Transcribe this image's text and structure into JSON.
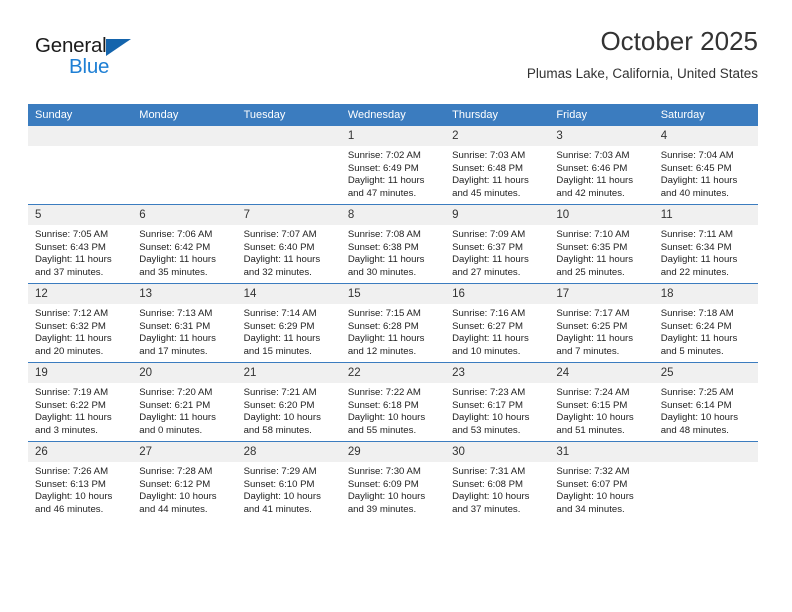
{
  "brand": {
    "name_top": "General",
    "name_bottom": "Blue",
    "triangle_color": "#1464ac",
    "blue_color": "#1e7fd4"
  },
  "header": {
    "title": "October 2025",
    "subtitle": "Plumas Lake, California, United States"
  },
  "theme": {
    "header_blue": "#3b7cbf",
    "daynum_gray": "#f0f0f0",
    "text": "#222222"
  },
  "weekdays": [
    "Sunday",
    "Monday",
    "Tuesday",
    "Wednesday",
    "Thursday",
    "Friday",
    "Saturday"
  ],
  "weeks": [
    [
      {
        "day": "",
        "empty": true
      },
      {
        "day": "",
        "empty": true
      },
      {
        "day": "",
        "empty": true
      },
      {
        "day": "1",
        "sunrise": "Sunrise: 7:02 AM",
        "sunset": "Sunset: 6:49 PM",
        "daylight_1": "Daylight: 11 hours",
        "daylight_2": "and 47 minutes."
      },
      {
        "day": "2",
        "sunrise": "Sunrise: 7:03 AM",
        "sunset": "Sunset: 6:48 PM",
        "daylight_1": "Daylight: 11 hours",
        "daylight_2": "and 45 minutes."
      },
      {
        "day": "3",
        "sunrise": "Sunrise: 7:03 AM",
        "sunset": "Sunset: 6:46 PM",
        "daylight_1": "Daylight: 11 hours",
        "daylight_2": "and 42 minutes."
      },
      {
        "day": "4",
        "sunrise": "Sunrise: 7:04 AM",
        "sunset": "Sunset: 6:45 PM",
        "daylight_1": "Daylight: 11 hours",
        "daylight_2": "and 40 minutes."
      }
    ],
    [
      {
        "day": "5",
        "sunrise": "Sunrise: 7:05 AM",
        "sunset": "Sunset: 6:43 PM",
        "daylight_1": "Daylight: 11 hours",
        "daylight_2": "and 37 minutes."
      },
      {
        "day": "6",
        "sunrise": "Sunrise: 7:06 AM",
        "sunset": "Sunset: 6:42 PM",
        "daylight_1": "Daylight: 11 hours",
        "daylight_2": "and 35 minutes."
      },
      {
        "day": "7",
        "sunrise": "Sunrise: 7:07 AM",
        "sunset": "Sunset: 6:40 PM",
        "daylight_1": "Daylight: 11 hours",
        "daylight_2": "and 32 minutes."
      },
      {
        "day": "8",
        "sunrise": "Sunrise: 7:08 AM",
        "sunset": "Sunset: 6:38 PM",
        "daylight_1": "Daylight: 11 hours",
        "daylight_2": "and 30 minutes."
      },
      {
        "day": "9",
        "sunrise": "Sunrise: 7:09 AM",
        "sunset": "Sunset: 6:37 PM",
        "daylight_1": "Daylight: 11 hours",
        "daylight_2": "and 27 minutes."
      },
      {
        "day": "10",
        "sunrise": "Sunrise: 7:10 AM",
        "sunset": "Sunset: 6:35 PM",
        "daylight_1": "Daylight: 11 hours",
        "daylight_2": "and 25 minutes."
      },
      {
        "day": "11",
        "sunrise": "Sunrise: 7:11 AM",
        "sunset": "Sunset: 6:34 PM",
        "daylight_1": "Daylight: 11 hours",
        "daylight_2": "and 22 minutes."
      }
    ],
    [
      {
        "day": "12",
        "sunrise": "Sunrise: 7:12 AM",
        "sunset": "Sunset: 6:32 PM",
        "daylight_1": "Daylight: 11 hours",
        "daylight_2": "and 20 minutes."
      },
      {
        "day": "13",
        "sunrise": "Sunrise: 7:13 AM",
        "sunset": "Sunset: 6:31 PM",
        "daylight_1": "Daylight: 11 hours",
        "daylight_2": "and 17 minutes."
      },
      {
        "day": "14",
        "sunrise": "Sunrise: 7:14 AM",
        "sunset": "Sunset: 6:29 PM",
        "daylight_1": "Daylight: 11 hours",
        "daylight_2": "and 15 minutes."
      },
      {
        "day": "15",
        "sunrise": "Sunrise: 7:15 AM",
        "sunset": "Sunset: 6:28 PM",
        "daylight_1": "Daylight: 11 hours",
        "daylight_2": "and 12 minutes."
      },
      {
        "day": "16",
        "sunrise": "Sunrise: 7:16 AM",
        "sunset": "Sunset: 6:27 PM",
        "daylight_1": "Daylight: 11 hours",
        "daylight_2": "and 10 minutes."
      },
      {
        "day": "17",
        "sunrise": "Sunrise: 7:17 AM",
        "sunset": "Sunset: 6:25 PM",
        "daylight_1": "Daylight: 11 hours",
        "daylight_2": "and 7 minutes."
      },
      {
        "day": "18",
        "sunrise": "Sunrise: 7:18 AM",
        "sunset": "Sunset: 6:24 PM",
        "daylight_1": "Daylight: 11 hours",
        "daylight_2": "and 5 minutes."
      }
    ],
    [
      {
        "day": "19",
        "sunrise": "Sunrise: 7:19 AM",
        "sunset": "Sunset: 6:22 PM",
        "daylight_1": "Daylight: 11 hours",
        "daylight_2": "and 3 minutes."
      },
      {
        "day": "20",
        "sunrise": "Sunrise: 7:20 AM",
        "sunset": "Sunset: 6:21 PM",
        "daylight_1": "Daylight: 11 hours",
        "daylight_2": "and 0 minutes."
      },
      {
        "day": "21",
        "sunrise": "Sunrise: 7:21 AM",
        "sunset": "Sunset: 6:20 PM",
        "daylight_1": "Daylight: 10 hours",
        "daylight_2": "and 58 minutes."
      },
      {
        "day": "22",
        "sunrise": "Sunrise: 7:22 AM",
        "sunset": "Sunset: 6:18 PM",
        "daylight_1": "Daylight: 10 hours",
        "daylight_2": "and 55 minutes."
      },
      {
        "day": "23",
        "sunrise": "Sunrise: 7:23 AM",
        "sunset": "Sunset: 6:17 PM",
        "daylight_1": "Daylight: 10 hours",
        "daylight_2": "and 53 minutes."
      },
      {
        "day": "24",
        "sunrise": "Sunrise: 7:24 AM",
        "sunset": "Sunset: 6:15 PM",
        "daylight_1": "Daylight: 10 hours",
        "daylight_2": "and 51 minutes."
      },
      {
        "day": "25",
        "sunrise": "Sunrise: 7:25 AM",
        "sunset": "Sunset: 6:14 PM",
        "daylight_1": "Daylight: 10 hours",
        "daylight_2": "and 48 minutes."
      }
    ],
    [
      {
        "day": "26",
        "sunrise": "Sunrise: 7:26 AM",
        "sunset": "Sunset: 6:13 PM",
        "daylight_1": "Daylight: 10 hours",
        "daylight_2": "and 46 minutes."
      },
      {
        "day": "27",
        "sunrise": "Sunrise: 7:28 AM",
        "sunset": "Sunset: 6:12 PM",
        "daylight_1": "Daylight: 10 hours",
        "daylight_2": "and 44 minutes."
      },
      {
        "day": "28",
        "sunrise": "Sunrise: 7:29 AM",
        "sunset": "Sunset: 6:10 PM",
        "daylight_1": "Daylight: 10 hours",
        "daylight_2": "and 41 minutes."
      },
      {
        "day": "29",
        "sunrise": "Sunrise: 7:30 AM",
        "sunset": "Sunset: 6:09 PM",
        "daylight_1": "Daylight: 10 hours",
        "daylight_2": "and 39 minutes."
      },
      {
        "day": "30",
        "sunrise": "Sunrise: 7:31 AM",
        "sunset": "Sunset: 6:08 PM",
        "daylight_1": "Daylight: 10 hours",
        "daylight_2": "and 37 minutes."
      },
      {
        "day": "31",
        "sunrise": "Sunrise: 7:32 AM",
        "sunset": "Sunset: 6:07 PM",
        "daylight_1": "Daylight: 10 hours",
        "daylight_2": "and 34 minutes."
      },
      {
        "day": "",
        "empty": true
      }
    ]
  ]
}
